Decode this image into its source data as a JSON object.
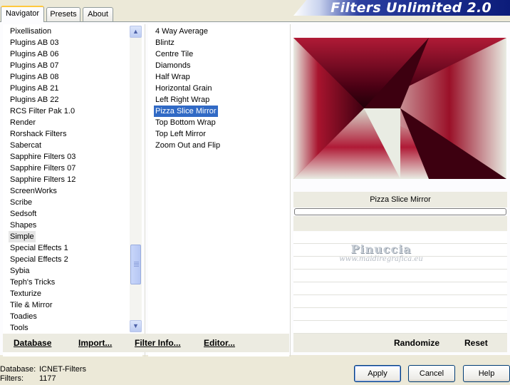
{
  "tabs": [
    {
      "label": "Navigator"
    },
    {
      "label": "Presets"
    },
    {
      "label": "About"
    }
  ],
  "app_title": "Filters Unlimited 2.0",
  "categories": [
    "Pixellisation",
    "Plugins AB 03",
    "Plugins AB 06",
    "Plugins AB 07",
    "Plugins AB 08",
    "Plugins AB 21",
    "Plugins AB 22",
    "RCS Filter Pak 1.0",
    "Render",
    "Rorshack Filters",
    "Sabercat",
    "Sapphire Filters 03",
    "Sapphire Filters 07",
    "Sapphire Filters 12",
    "ScreenWorks",
    "Scribe",
    "Sedsoft",
    "Shapes",
    "Simple",
    "Special Effects 1",
    "Special Effects 2",
    "Sybia",
    "Teph's Tricks",
    "Texturize",
    "Tile & Mirror",
    "Toadies",
    "Tools"
  ],
  "selected_category": "Simple",
  "filters": [
    "4 Way Average",
    "Blintz",
    "Centre Tile",
    "Diamonds",
    "Half Wrap",
    "Horizontal Grain",
    "Left Right Wrap",
    "Pizza Slice Mirror",
    "Top Bottom Wrap",
    "Top Left Mirror",
    "Zoom Out and Flip"
  ],
  "selected_filter": "Pizza Slice Mirror",
  "preview": {
    "filter_name": "Pizza Slice Mirror",
    "colors": {
      "dark": "#3d0010",
      "crimson": "#a8142e",
      "light": "#e9ece3"
    }
  },
  "watermark": {
    "name": "Pinuccia",
    "url": "www.maidiregrafica.eu"
  },
  "actions": {
    "database": "Database",
    "import": "Import...",
    "filter_info": "Filter Info...",
    "editor": "Editor...",
    "randomize": "Randomize",
    "reset": "Reset"
  },
  "footer": {
    "database_label": "Database:",
    "database_value": "ICNET-Filters",
    "filters_label": "Filters:",
    "filters_value": "1177"
  },
  "buttons": {
    "apply": "Apply",
    "cancel": "Cancel",
    "help": "Help"
  },
  "icons": {
    "scroll_up": "chevron-up-icon",
    "scroll_down": "chevron-down-icon"
  }
}
